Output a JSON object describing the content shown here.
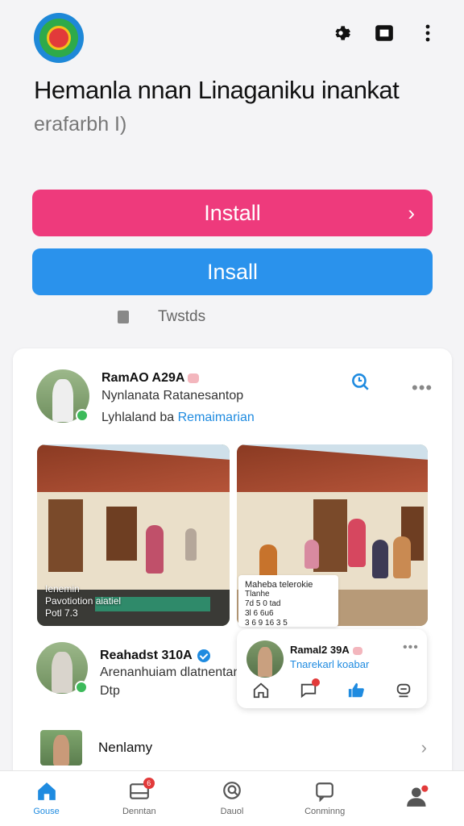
{
  "header": {
    "logo_icon": "app-emblem-icon",
    "icons": [
      "gear-icon",
      "window-icon",
      "more-vertical-icon"
    ]
  },
  "app": {
    "title": "Hemanla nnan Linaganiku inankat",
    "subtitle": "erafarbh I)"
  },
  "actions": {
    "primary_label": "Install",
    "secondary_label": "Insall",
    "tweets_label": "Twstds",
    "primary_color": "#ee3a7c",
    "secondary_color": "#2a92ec"
  },
  "post": {
    "author": "RamAO A29A",
    "line1": "Nynlanata Ratanesantop",
    "line2_prefix": "Lyhlaland ba",
    "line2_link": "Remaimarian",
    "photo1_caption_1": "Ienemin",
    "photo1_caption_2": "Pavotiotion aiatiel",
    "photo1_caption_3": "Potl 7.3",
    "notice_title": "Maheba telerokie",
    "notice_line1": "Tlanhe",
    "notice_line2": "7d 5 0 tad",
    "notice_line3": "3l 6 6u6",
    "notice_line4": "3 6 9 16 3 5"
  },
  "post2": {
    "author": "Reahadst 310A",
    "line1": "Arenanhuiam dlatnentan",
    "line2": "Dtp"
  },
  "mini_card": {
    "author": "Ramal2 39A",
    "link": "Tnarekarl koabar",
    "icons": [
      "home-icon",
      "chat-icon",
      "like-icon",
      "comment-icon"
    ]
  },
  "list": {
    "label": "Nenlamy"
  },
  "nav": {
    "items": [
      {
        "label": "Gouse",
        "icon": "home-icon"
      },
      {
        "label": "Denntan",
        "icon": "inbox-icon",
        "badge": "6"
      },
      {
        "label": "Dauol",
        "icon": "search-icon"
      },
      {
        "label": "Conminng",
        "icon": "chat-icon"
      },
      {
        "label": "",
        "icon": "profile-icon"
      }
    ]
  }
}
